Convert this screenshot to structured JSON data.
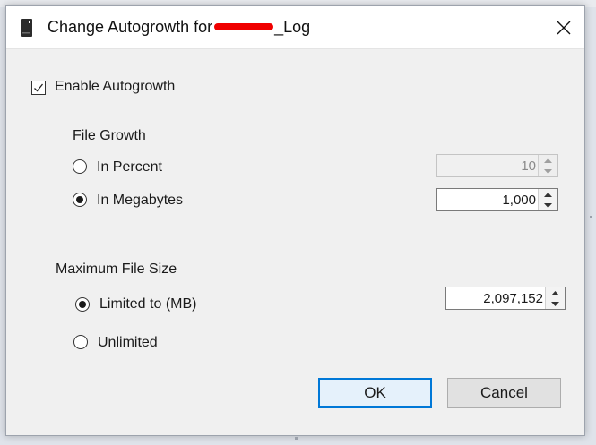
{
  "dialog": {
    "title_prefix": "Change Autogrowth for",
    "title_suffix": "_Log",
    "close_glyph": "✕"
  },
  "enable": {
    "label": "Enable Autogrowth",
    "checked": true
  },
  "file_growth": {
    "heading": "File Growth",
    "percent_label": "In Percent",
    "percent_value": "10",
    "percent_selected": false,
    "megabytes_label": "In Megabytes",
    "megabytes_value": "1,000",
    "megabytes_selected": true
  },
  "max_size": {
    "heading": "Maximum File Size",
    "limited_label": "Limited to (MB)",
    "limited_value": "2,097,152",
    "limited_selected": true,
    "unlimited_label": "Unlimited",
    "unlimited_selected": false
  },
  "buttons": {
    "ok": "OK",
    "cancel": "Cancel"
  },
  "icons": {
    "title": "database-file-icon",
    "close": "close-icon",
    "spin_up": "spin-up-arrow-icon",
    "spin_down": "spin-down-arrow-icon"
  }
}
